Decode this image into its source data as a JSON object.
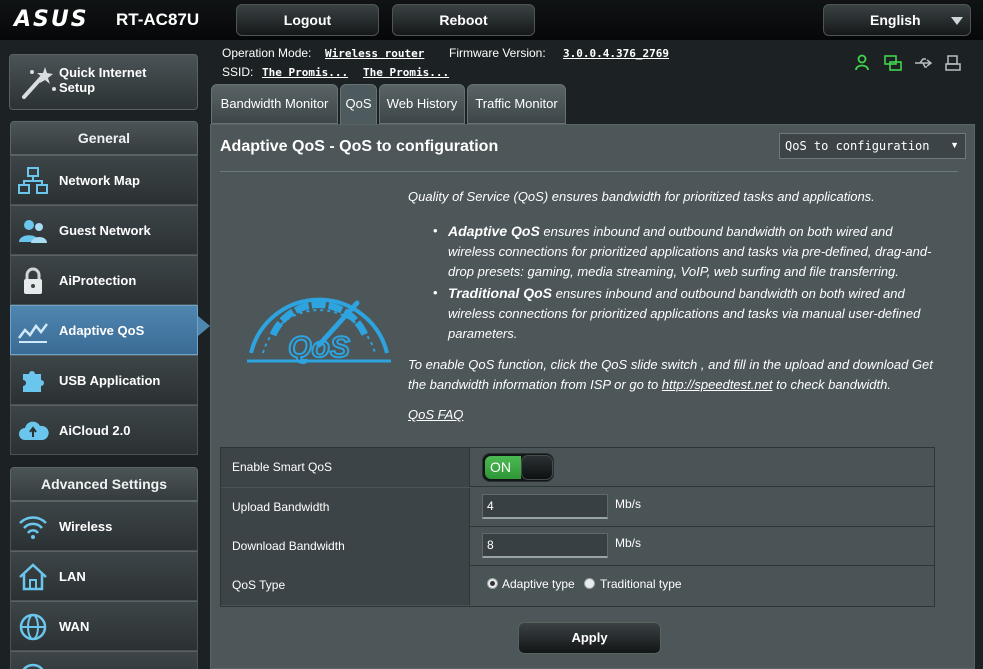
{
  "header": {
    "brand": "ASUS",
    "model": "RT-AC87U",
    "logout_label": "Logout",
    "reboot_label": "Reboot",
    "language": "English"
  },
  "info": {
    "operation_mode_label": "Operation Mode:",
    "operation_mode_value": "Wireless router",
    "firmware_label": "Firmware Version:",
    "firmware_value": "3.0.0.4.376_2769",
    "ssid_label": "SSID:",
    "ssid_1": "The Promis...",
    "ssid_2": "The Promis..."
  },
  "sidebar": {
    "quick_setup": "Quick Internet Setup",
    "general_header": "General",
    "general_items": [
      {
        "label": "Network Map",
        "icon": "network-map-icon"
      },
      {
        "label": "Guest Network",
        "icon": "guest-network-icon"
      },
      {
        "label": "AiProtection",
        "icon": "lock-icon"
      },
      {
        "label": "Adaptive QoS",
        "icon": "qos-graph-icon",
        "active": true
      },
      {
        "label": "USB Application",
        "icon": "puzzle-icon"
      },
      {
        "label": "AiCloud 2.0",
        "icon": "cloud-icon"
      }
    ],
    "advanced_header": "Advanced Settings",
    "advanced_items": [
      {
        "label": "Wireless",
        "icon": "wifi-icon"
      },
      {
        "label": "LAN",
        "icon": "home-icon"
      },
      {
        "label": "WAN",
        "icon": "globe-icon"
      }
    ]
  },
  "tabs": [
    {
      "label": "Bandwidth Monitor"
    },
    {
      "label": "QoS",
      "active": true
    },
    {
      "label": "Web History"
    },
    {
      "label": "Traffic Monitor"
    }
  ],
  "main": {
    "title": "Adaptive QoS - QoS to configuration",
    "config_select": "QoS to configuration",
    "intro": "Quality of Service (QoS) ensures bandwidth for prioritized tasks and applications.",
    "bullets": [
      {
        "term": "Adaptive QoS",
        "text": " ensures inbound and outbound bandwidth on both wired and wireless connections for prioritized applications and tasks via pre-defined, drag-and-drop presets: gaming, media streaming, VoIP, web surfing and file transferring."
      },
      {
        "term": "Traditional QoS",
        "text": " ensures inbound and outbound bandwidth on both wired and wireless connections for prioritized applications and tasks via manual user-defined parameters."
      }
    ],
    "enable_text_1": "To enable QoS function, click the QoS slide switch , and fill in the upload and download Get the bandwidth information from ISP or go to ",
    "speedtest_link": "http://speedtest.net",
    "enable_text_2": " to check bandwidth.",
    "faq_link": "QoS FAQ",
    "gauge_text": "QoS"
  },
  "settings": {
    "smart_qos_label": "Enable Smart QoS",
    "smart_qos_state": "ON",
    "upload_label": "Upload Bandwidth",
    "upload_value": "4",
    "upload_unit": "Mb/s",
    "download_label": "Download Bandwidth",
    "download_value": "8",
    "download_unit": "Mb/s",
    "qos_type_label": "QoS Type",
    "qos_type_options": [
      "Adaptive type",
      "Traditional type"
    ],
    "qos_type_selected": "Adaptive type",
    "apply_label": "Apply"
  },
  "colors": {
    "active_blue": "#4f86b0",
    "toggle_green": "#3aa842",
    "gauge_blue": "#2da4df"
  }
}
